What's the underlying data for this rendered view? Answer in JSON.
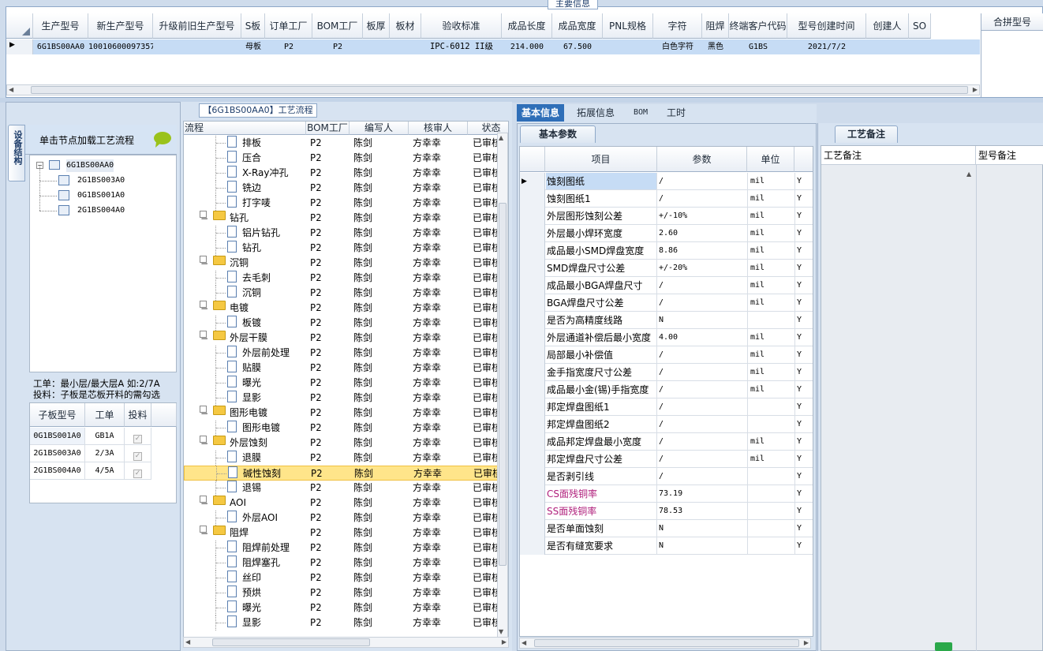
{
  "top": {
    "legend": "主要信息",
    "columns": [
      "生产型号",
      "新生产型号",
      "升级前旧生产型号",
      "S板",
      "订单工厂",
      "BOM工厂",
      "板厚",
      "板材",
      "验收标准",
      "成品长度",
      "成品宽度",
      "PNL规格",
      "字符",
      "阻焊",
      "终端客户代码",
      "型号创建时间",
      "创建人",
      "SO"
    ],
    "row": [
      "6G1BS00AA0",
      "10010600097357",
      "",
      "母板",
      "P2",
      "P2",
      "",
      "",
      "IPC-6012 II级",
      "214.000",
      "67.500",
      "",
      "白色字符",
      "黑色",
      "G1BS",
      "2021/7/2",
      "",
      ""
    ],
    "right_col": "合拼型号"
  },
  "left": {
    "vtab": "设备结构",
    "banner": "单击节点加载工艺流程",
    "tree_root": "6G1BS00AA0",
    "tree_children": [
      "2G1BS003A0",
      "0G1BS001A0",
      "2G1BS004A0"
    ],
    "note1": "工单：最小层/最大层A 如:2/7A",
    "note2": "投料：子板是芯板开料的需勾选",
    "sub_headers": [
      "子板型号",
      "工单",
      "投料"
    ],
    "sub_rows": [
      [
        "0G1BS001A0",
        "GB1A"
      ],
      [
        "2G1BS003A0",
        "2/3A"
      ],
      [
        "2G1BS004A0",
        "4/5A"
      ]
    ]
  },
  "mid": {
    "legend": "【6G1BS00AA0】工艺流程",
    "headers": [
      "流程",
      "BOM工厂",
      "编写人",
      "核审人",
      "状态"
    ],
    "rows": [
      {
        "t": "d",
        "n": "排板"
      },
      {
        "t": "d",
        "n": "压合"
      },
      {
        "t": "d",
        "n": "X-Ray冲孔"
      },
      {
        "t": "d",
        "n": "铣边"
      },
      {
        "t": "d",
        "n": "打字唛"
      },
      {
        "t": "f",
        "n": "钻孔"
      },
      {
        "t": "d",
        "n": "铝片钻孔"
      },
      {
        "t": "d",
        "n": "钻孔"
      },
      {
        "t": "f",
        "n": "沉铜"
      },
      {
        "t": "d",
        "n": "去毛刺"
      },
      {
        "t": "d",
        "n": "沉铜"
      },
      {
        "t": "f",
        "n": "电镀"
      },
      {
        "t": "d",
        "n": "板镀"
      },
      {
        "t": "f",
        "n": "外层干膜"
      },
      {
        "t": "d",
        "n": "外层前处理"
      },
      {
        "t": "d",
        "n": "贴膜"
      },
      {
        "t": "d",
        "n": "曝光"
      },
      {
        "t": "d",
        "n": "显影"
      },
      {
        "t": "f",
        "n": "图形电镀"
      },
      {
        "t": "d",
        "n": "图形电镀"
      },
      {
        "t": "f",
        "n": "外层蚀刻"
      },
      {
        "t": "d",
        "n": "退膜"
      },
      {
        "t": "d",
        "n": "碱性蚀刻",
        "sel": true
      },
      {
        "t": "d",
        "n": "退锡"
      },
      {
        "t": "f",
        "n": "AOI"
      },
      {
        "t": "d",
        "n": "外层AOI"
      },
      {
        "t": "f",
        "n": "阻焊"
      },
      {
        "t": "d",
        "n": "阻焊前处理"
      },
      {
        "t": "d",
        "n": "阻焊塞孔"
      },
      {
        "t": "d",
        "n": "丝印"
      },
      {
        "t": "d",
        "n": "预烘"
      },
      {
        "t": "d",
        "n": "曝光"
      },
      {
        "t": "d",
        "n": "显影"
      }
    ],
    "bom": "P2",
    "writer": "陈剑",
    "auditor": "方幸幸",
    "status": "已审核"
  },
  "right": {
    "tabs": [
      "基本信息",
      "拓展信息",
      "BOM",
      "工时"
    ],
    "subtab": "基本参数",
    "headers": [
      "项目",
      "参数",
      "单位"
    ],
    "rows": [
      [
        "蚀刻图纸",
        "/",
        "mil",
        "Y"
      ],
      [
        "蚀刻图纸1",
        "/",
        "mil",
        "Y"
      ],
      [
        "外层图形蚀刻公差",
        "+/-10%",
        "mil",
        "Y"
      ],
      [
        "外层最小焊环宽度",
        "2.60",
        "mil",
        "Y"
      ],
      [
        "成品最小SMD焊盘宽度",
        "8.86",
        "mil",
        "Y"
      ],
      [
        "SMD焊盘尺寸公差",
        "+/-20%",
        "mil",
        "Y"
      ],
      [
        "成品最小BGA焊盘尺寸",
        "/",
        "mil",
        "Y"
      ],
      [
        "BGA焊盘尺寸公差",
        "/",
        "mil",
        "Y"
      ],
      [
        "是否为高精度线路",
        "N",
        "",
        "Y"
      ],
      [
        "外层通道补偿后最小宽度",
        "4.00",
        "mil",
        "Y"
      ],
      [
        "局部最小补偿值",
        "/",
        "mil",
        "Y"
      ],
      [
        "金手指宽度尺寸公差",
        "/",
        "mil",
        "Y"
      ],
      [
        "成品最小金(锡)手指宽度",
        "/",
        "mil",
        "Y"
      ],
      [
        "邦定焊盘图纸1",
        "/",
        "",
        "Y"
      ],
      [
        "邦定焊盘图纸2",
        "/",
        "",
        "Y"
      ],
      [
        "成品邦定焊盘最小宽度",
        "/",
        "mil",
        "Y"
      ],
      [
        "邦定焊盘尺寸公差",
        "/",
        "mil",
        "Y"
      ],
      [
        "是否剥引线",
        "/",
        "",
        "Y"
      ],
      [
        "CS面残铜率",
        "73.19",
        "",
        "Y"
      ],
      [
        "SS面残铜率",
        "78.53",
        "",
        "Y"
      ],
      [
        "是否单面蚀刻",
        "N",
        "",
        "Y"
      ],
      [
        "是否有缝宽要求",
        "N",
        "",
        "Y"
      ]
    ],
    "remark_tab": "工艺备注",
    "remark_headers": [
      "工艺备注",
      "型号备注"
    ]
  },
  "colors": {
    "accent": "#2f6fb8",
    "select": "#ffe58a",
    "row_blue": "#c6dcf5",
    "pink": "#b0207c"
  }
}
